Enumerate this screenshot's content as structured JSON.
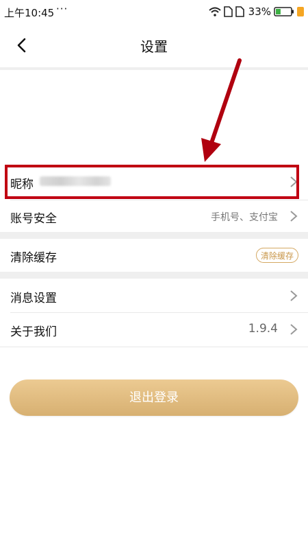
{
  "status_bar": {
    "time": "上午10:45",
    "dots": "···",
    "battery_pct": "33%",
    "battery_level": 0.33
  },
  "nav": {
    "title": "设置"
  },
  "rows": {
    "nickname": {
      "label": "昵称"
    },
    "account": {
      "label": "账号安全",
      "value": "手机号、支付宝"
    },
    "cache": {
      "label": "清除缓存",
      "button": "清除缓存"
    },
    "notify": {
      "label": "消息设置"
    },
    "about": {
      "label": "关于我们",
      "value": "1.9.4"
    }
  },
  "logout": {
    "label": "退出登录"
  },
  "colors": {
    "accent": "#d4a862",
    "annotation": "#c00012"
  }
}
